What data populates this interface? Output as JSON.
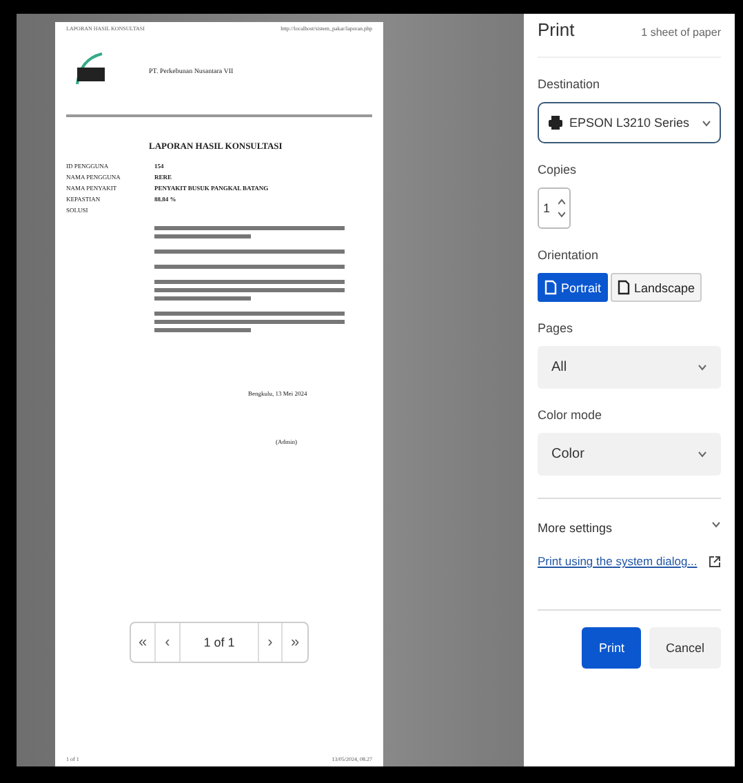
{
  "preview": {
    "header_left": "LAPORAN HASIL KONSULTASI",
    "header_right": "http://localhost/sistem_pakar/laporan.php",
    "company": "PT. Perkebunan Nusantara VII",
    "title": "LAPORAN HASIL KONSULTASI",
    "fields": [
      {
        "label": "ID PENGGUNA",
        "value": "154"
      },
      {
        "label": "NAMA PENGGUNA",
        "value": "RERE"
      },
      {
        "label": "NAMA PENYAKIT",
        "value": "PENYAKIT BUSUK PANGKAL BATANG"
      },
      {
        "label": "KEPASTIAN",
        "value": "88.84 %"
      },
      {
        "label": "SOLUSI"
      }
    ],
    "place_date": "Bengkulu, 13 Mei 2024",
    "signature": "(Admin)",
    "footer_left": "1 of 1",
    "footer_right": "13/05/2024, 08.27",
    "pager": {
      "first": "«",
      "prev": "‹",
      "page": "1 of 1",
      "next": "›",
      "last": "»"
    }
  },
  "panel": {
    "title": "Print",
    "sheets": "1 sheet of paper",
    "destination": {
      "label": "Destination",
      "value": "EPSON L3210 Series"
    },
    "copies": {
      "label": "Copies",
      "value": "1"
    },
    "orientation": {
      "label": "Orientation",
      "options": [
        {
          "label": "Portrait",
          "selected": true
        },
        {
          "label": "Landscape",
          "selected": false
        }
      ]
    },
    "pages": {
      "label": "Pages",
      "value": "All"
    },
    "color_mode": {
      "label": "Color mode",
      "value": "Color"
    },
    "more_settings": {
      "label": "More settings",
      "expanded": false
    },
    "system_dialog": "Print using the system dialog...",
    "buttons": [
      {
        "label": "Print",
        "kind": "primary"
      },
      {
        "label": "Cancel",
        "kind": "secondary"
      }
    ]
  }
}
